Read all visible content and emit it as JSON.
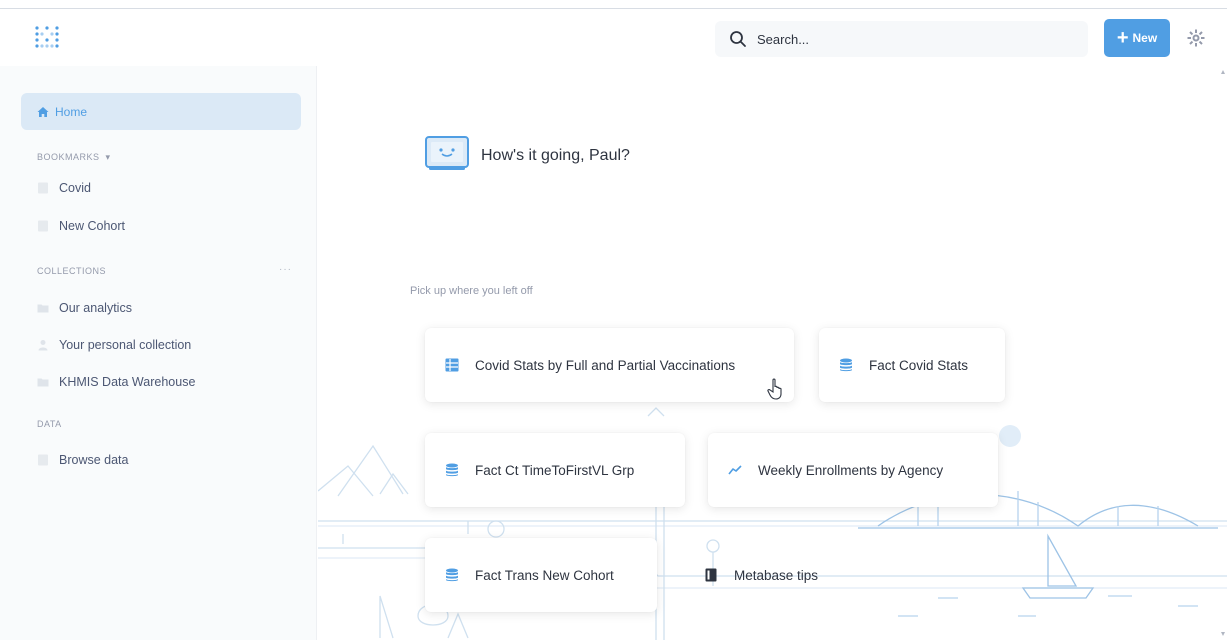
{
  "header": {
    "search_placeholder": "Search...",
    "new_button_label": "New"
  },
  "sidebar": {
    "home_label": "Home",
    "bookmarks_heading": "BOOKMARKS",
    "bookmarks": [
      {
        "label": "Covid"
      },
      {
        "label": "New Cohort"
      }
    ],
    "collections_heading": "COLLECTIONS",
    "collections": [
      {
        "label": "Our analytics"
      },
      {
        "label": "Your personal collection"
      },
      {
        "label": "KHMIS Data Warehouse"
      }
    ],
    "data_heading": "DATA",
    "data_items": [
      {
        "label": "Browse data"
      }
    ]
  },
  "main": {
    "greeting": "How's it going, Paul?",
    "pickup_heading": "Pick up where you left off",
    "cards": [
      {
        "label": "Covid Stats by Full and Partial Vaccinations",
        "icon": "table-icon"
      },
      {
        "label": "Fact Covid Stats",
        "icon": "database-icon"
      },
      {
        "label": "Fact Ct TimeToFirstVL Grp",
        "icon": "database-icon"
      },
      {
        "label": "Weekly Enrollments by Agency",
        "icon": "line-chart-icon"
      },
      {
        "label": "Fact Trans New Cohort",
        "icon": "database-icon"
      },
      {
        "label": "Metabase tips",
        "icon": "book-icon"
      }
    ]
  },
  "colors": {
    "brand": "#509ee3",
    "sidebar_bg": "#f9fbfc",
    "active_bg": "#dbe9f6",
    "text_dark": "#2e3440",
    "text_muted": "#949aab"
  }
}
